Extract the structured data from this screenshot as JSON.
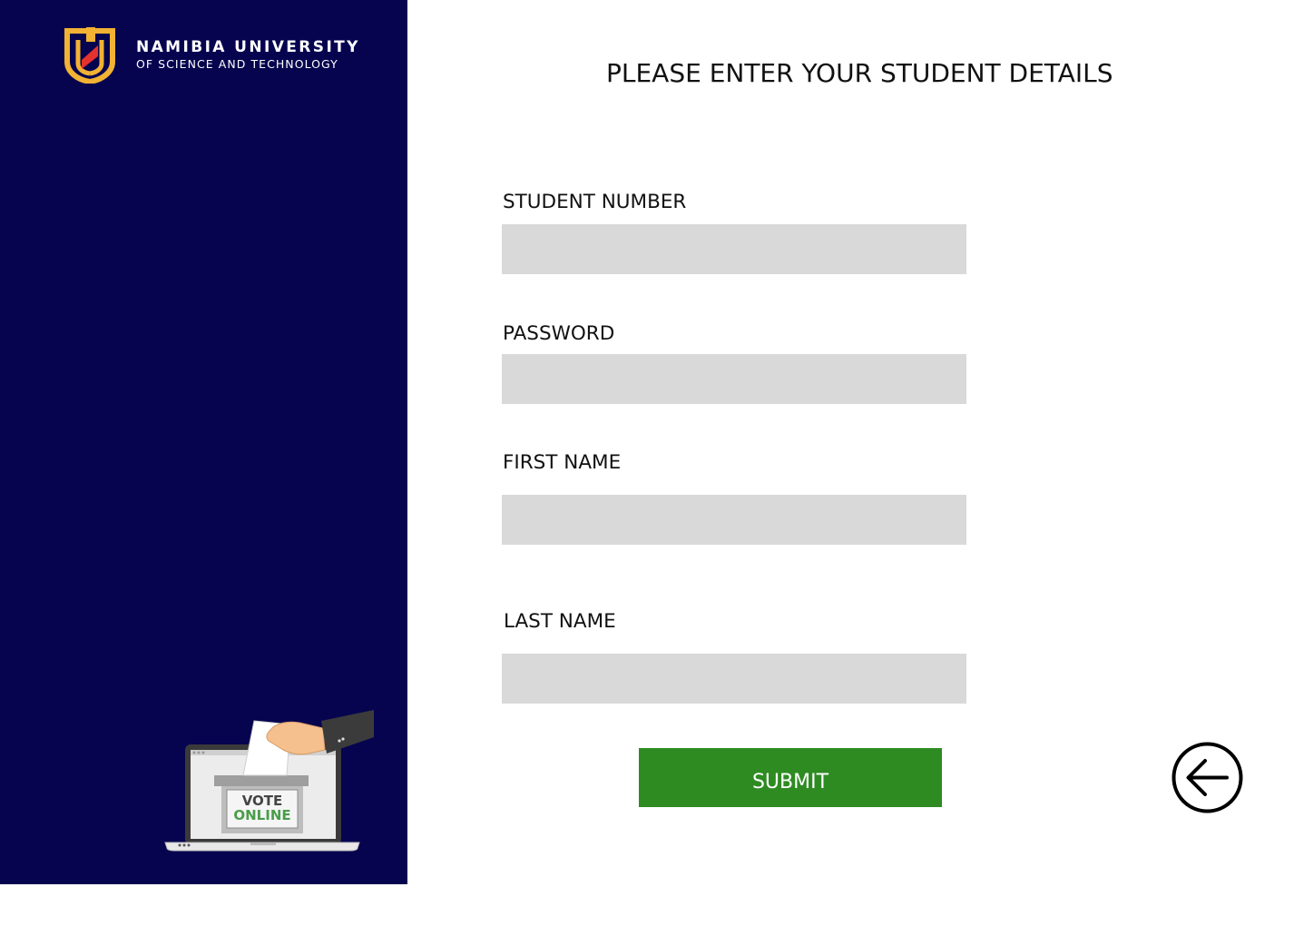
{
  "sidebar": {
    "brand": {
      "line1": "NAMIBIA UNIVERSITY",
      "line2": "OF SCIENCE AND TECHNOLOGY",
      "logo_icon": "nust-shield-logo",
      "logo_colors": {
        "gold": "#f2b233",
        "red": "#e5322d"
      }
    },
    "illustration": {
      "icon": "vote-online-laptop",
      "text_vote": "VOTE",
      "text_online": "ONLINE"
    },
    "background_color": "#06044f"
  },
  "main": {
    "title": "PLEASE ENTER YOUR STUDENT DETAILS",
    "fields": {
      "student_number": {
        "label": "STUDENT NUMBER",
        "value": "",
        "placeholder": ""
      },
      "password": {
        "label": "PASSWORD",
        "value": "",
        "placeholder": ""
      },
      "first_name": {
        "label": "FIRST NAME",
        "value": "",
        "placeholder": ""
      },
      "last_name": {
        "label": "LAST NAME",
        "value": "",
        "placeholder": ""
      }
    },
    "submit_label": "SUBMIT",
    "submit_color": "#2e8b22",
    "back_icon": "arrow-left-circle-icon"
  }
}
